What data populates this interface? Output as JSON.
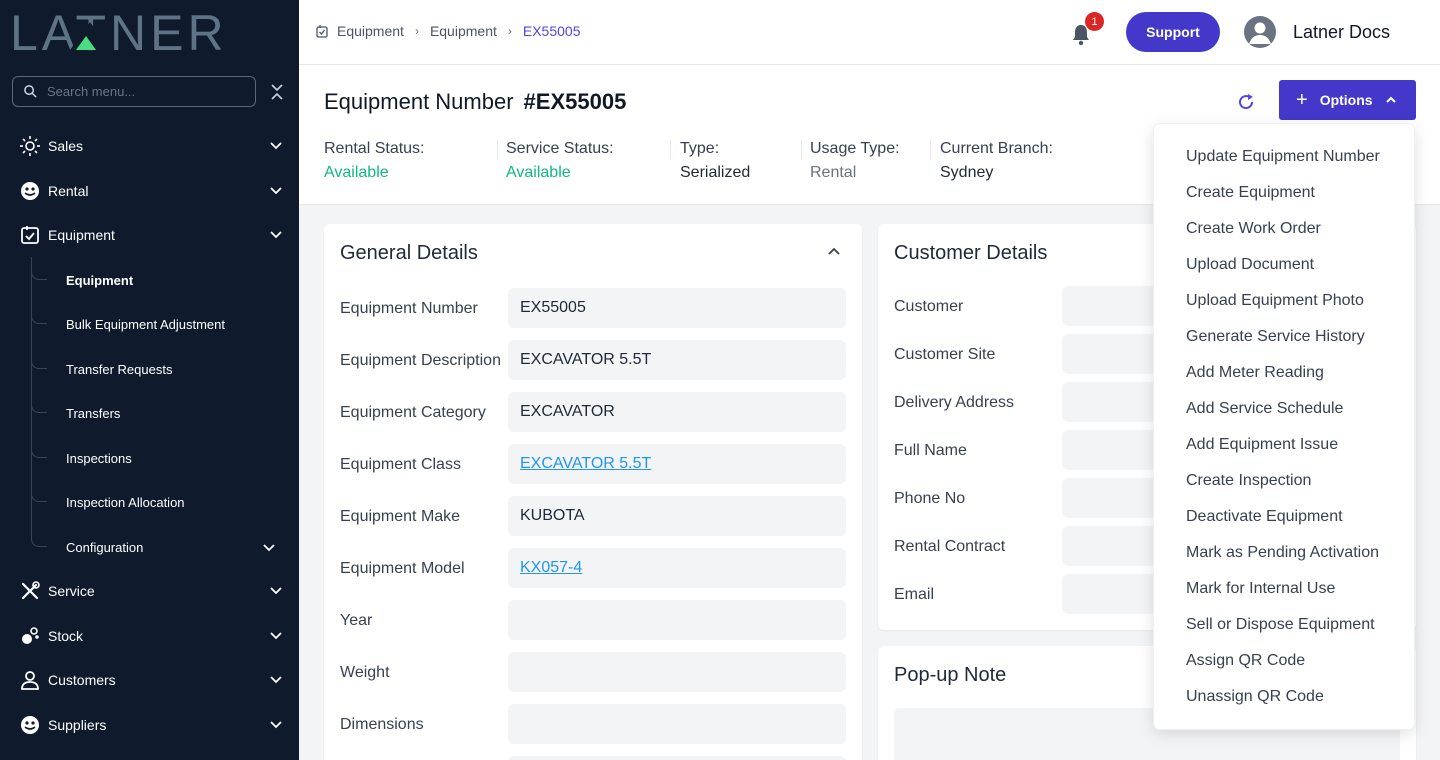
{
  "sidebar": {
    "logo": "LATNER",
    "search_placeholder": "Search menu...",
    "items": [
      {
        "label": "Sales",
        "icon": "sales-icon"
      },
      {
        "label": "Rental",
        "icon": "rental-icon"
      },
      {
        "label": "Equipment",
        "icon": "equipment-icon"
      },
      {
        "label": "Service",
        "icon": "service-icon"
      },
      {
        "label": "Stock",
        "icon": "stock-icon"
      },
      {
        "label": "Customers",
        "icon": "customers-icon"
      },
      {
        "label": "Suppliers",
        "icon": "suppliers-icon"
      }
    ],
    "sub_items": [
      {
        "label": "Equipment",
        "active": true
      },
      {
        "label": "Bulk Equipment Adjustment"
      },
      {
        "label": "Transfer Requests"
      },
      {
        "label": "Transfers"
      },
      {
        "label": "Inspections"
      },
      {
        "label": "Inspection Allocation"
      },
      {
        "label": "Configuration"
      }
    ]
  },
  "topbar": {
    "breadcrumb": [
      "Equipment",
      "Equipment",
      "EX55005"
    ],
    "notification_count": "1",
    "support_label": "Support",
    "user_name": "Latner Docs"
  },
  "header": {
    "title_label": "Equipment Number",
    "title_number": "#EX55005",
    "options_label": "Options",
    "stats": [
      {
        "label": "Rental Status:",
        "value": "Available"
      },
      {
        "label": "Service Status:",
        "value": "Available"
      },
      {
        "label": "Type:",
        "value": "Serialized"
      },
      {
        "label": "Usage Type:",
        "value": "Rental"
      },
      {
        "label": "Current Branch:",
        "value": "Sydney"
      }
    ]
  },
  "general": {
    "title": "General Details",
    "rows": [
      {
        "label": "Equipment Number",
        "value": "EX55005"
      },
      {
        "label": "Equipment Description",
        "value": "EXCAVATOR 5.5T"
      },
      {
        "label": "Equipment Category",
        "value": "EXCAVATOR"
      },
      {
        "label": "Equipment Class",
        "value": "EXCAVATOR 5.5T"
      },
      {
        "label": "Equipment Make",
        "value": "KUBOTA"
      },
      {
        "label": "Equipment Model",
        "value": "KX057-4"
      },
      {
        "label": "Year",
        "value": ""
      },
      {
        "label": "Weight",
        "value": ""
      },
      {
        "label": "Dimensions",
        "value": ""
      }
    ]
  },
  "customer": {
    "title": "Customer Details",
    "rows": [
      "Customer",
      "Customer Site",
      "Delivery Address",
      "Full Name",
      "Phone No",
      "Rental Contract",
      "Email"
    ]
  },
  "popup_note": {
    "title": "Pop-up Note"
  },
  "options_menu": [
    "Update Equipment Number",
    "Create Equipment",
    "Create Work Order",
    "Upload Document",
    "Upload Equipment Photo",
    "Generate Service History",
    "Add Meter Reading",
    "Add Service Schedule",
    "Add Equipment Issue",
    "Create Inspection",
    "Deactivate Equipment",
    "Mark as Pending Activation",
    "Mark for Internal Use",
    "Sell or Dispose Equipment",
    "Assign QR Code",
    "Unassign QR Code"
  ],
  "colors": {
    "sidebar_bg": "#0f1b2d",
    "accent": "#4338ca",
    "status_green": "#10b981",
    "link": "#2196f3",
    "badge_red": "#dc2626"
  }
}
